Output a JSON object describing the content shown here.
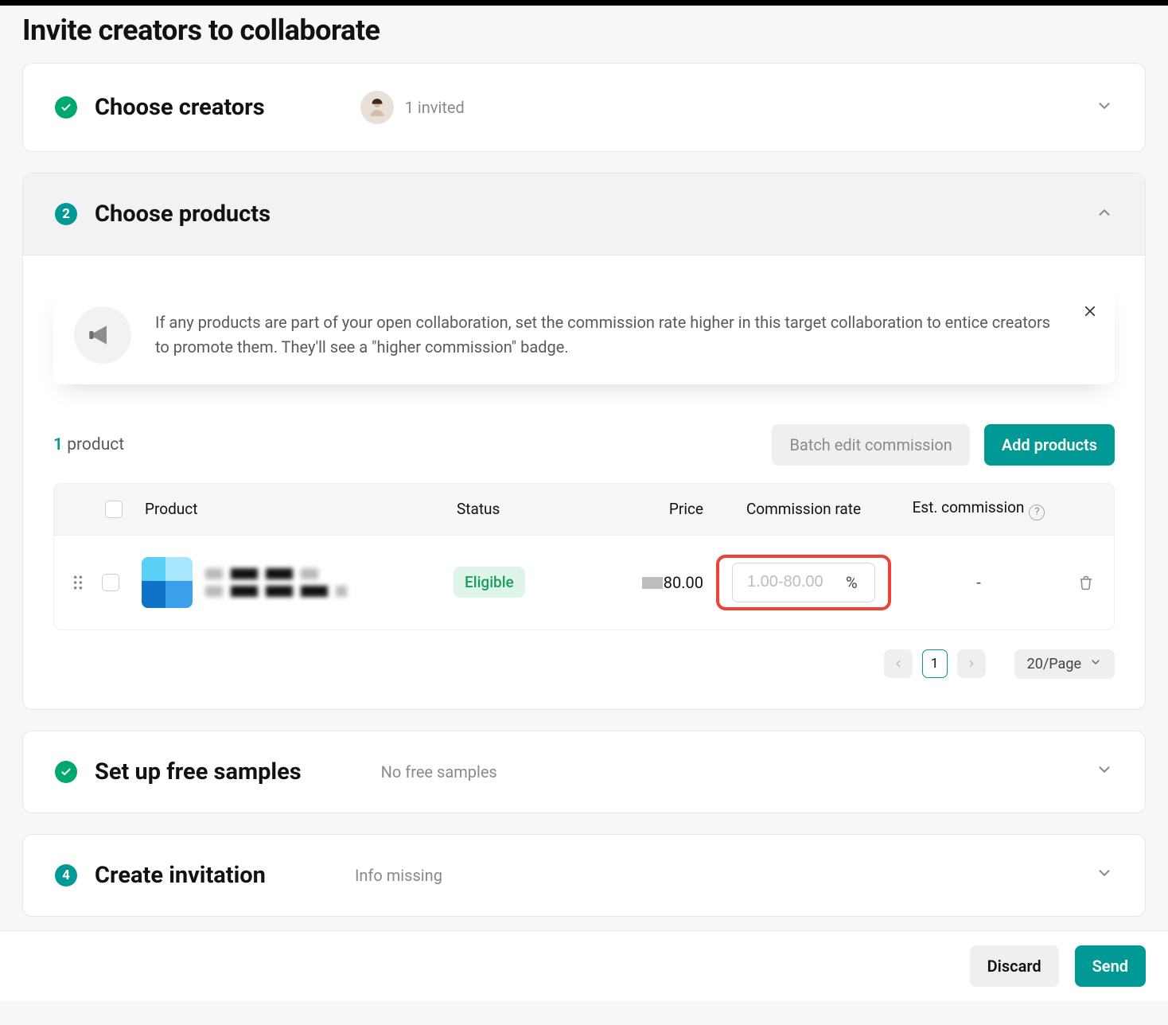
{
  "page": {
    "title": "Invite creators to collaborate"
  },
  "steps": {
    "s1": {
      "title": "Choose creators",
      "summary": "1 invited"
    },
    "s2": {
      "num": "2",
      "title": "Choose products",
      "alert": "If any products are part of your open collaboration, set the commission rate higher in this target collaboration to entice creators to promote them. They'll see a \"higher commission\" badge.",
      "count_n": "1",
      "count_label": " product",
      "batch_btn": "Batch edit commission",
      "add_btn": "Add products",
      "columns": {
        "product": "Product",
        "status": "Status",
        "price": "Price",
        "rate": "Commission rate",
        "est": "Est. commission"
      },
      "row": {
        "status": "Eligible",
        "price_visible": "80.00",
        "rate_value": "",
        "rate_placeholder": "1.00-80.00",
        "rate_unit": "%",
        "est": "-"
      },
      "pager": {
        "current": "1",
        "size": "20/Page"
      }
    },
    "s3": {
      "title": "Set up free samples",
      "summary": "No free samples"
    },
    "s4": {
      "num": "4",
      "title": "Create invitation",
      "summary": "Info missing"
    }
  },
  "footer": {
    "discard": "Discard",
    "send": "Send"
  }
}
